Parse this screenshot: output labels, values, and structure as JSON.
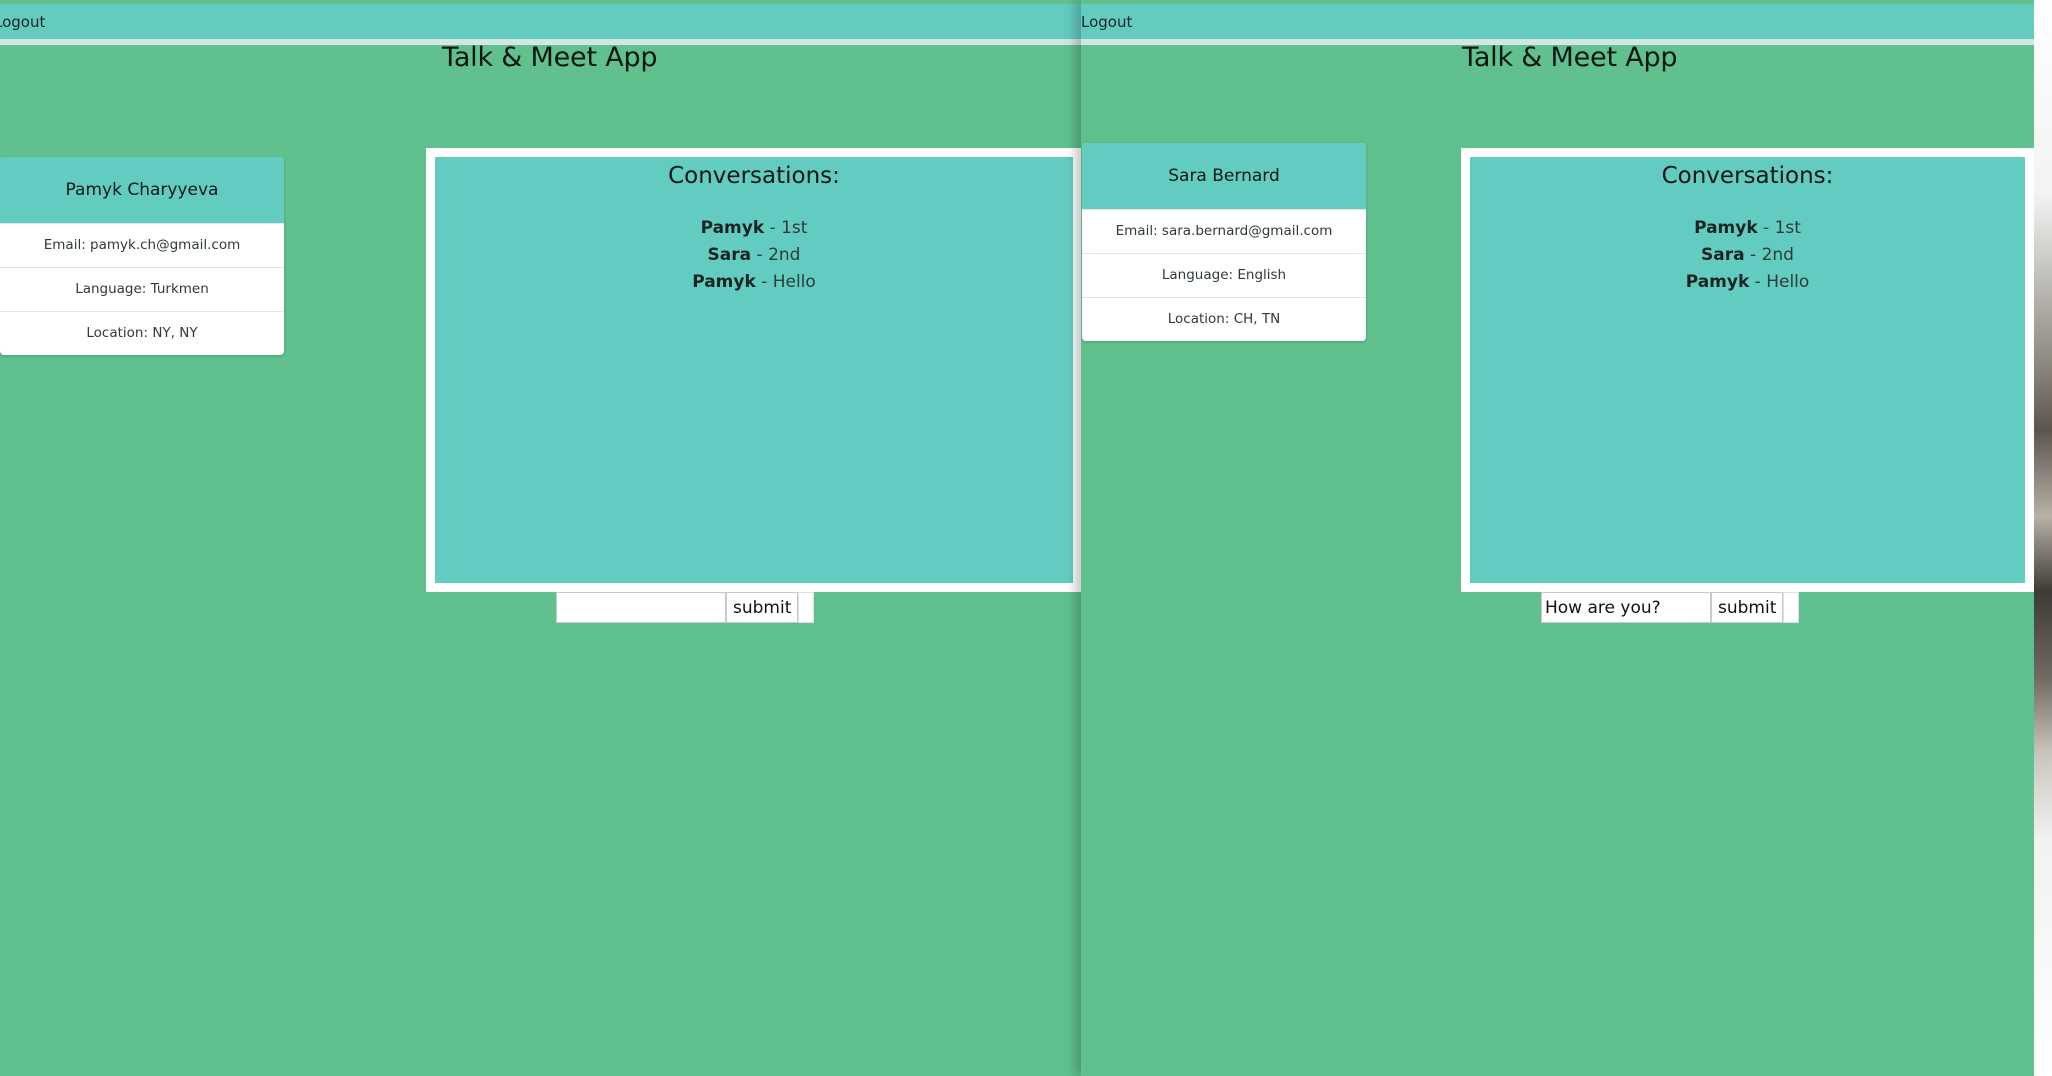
{
  "windows": [
    {
      "logout_label": "Logout",
      "app_title": "Talk & Meet App",
      "profile": {
        "name": "Pamyk Charyyeva",
        "email": "Email: pamyk.ch@gmail.com",
        "language": "Language: Turkmen",
        "location": "Location: NY, NY"
      },
      "conversations": {
        "title": "Conversations:",
        "messages": [
          {
            "sender": "Pamyk",
            "text": " - 1st"
          },
          {
            "sender": "Sara",
            "text": " - 2nd"
          },
          {
            "sender": "Pamyk",
            "text": " - Hello"
          }
        ]
      },
      "input_value": "",
      "submit_label": "submit"
    },
    {
      "logout_label": "Logout",
      "app_title": "Talk & Meet App",
      "profile": {
        "name": "Sara Bernard",
        "email": "Email: sara.bernard@gmail.com",
        "language": "Language: English",
        "location": "Location: CH, TN"
      },
      "conversations": {
        "title": "Conversations:",
        "messages": [
          {
            "sender": "Pamyk",
            "text": " - 1st"
          },
          {
            "sender": "Sara",
            "text": " - 2nd"
          },
          {
            "sender": "Pamyk",
            "text": " - Hello"
          }
        ]
      },
      "input_value": "How are you?",
      "submit_label": "submit"
    }
  ]
}
